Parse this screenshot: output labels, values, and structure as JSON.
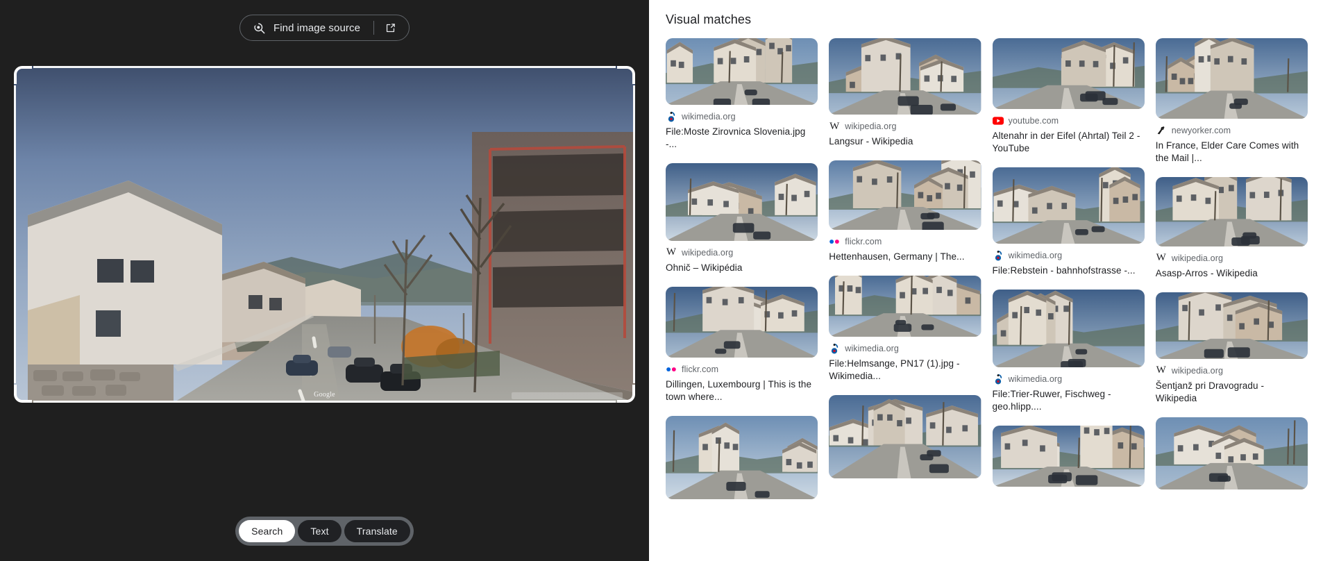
{
  "left": {
    "find_source": {
      "label": "Find image source",
      "search_icon": "image-search-lens-icon",
      "external_icon": "external-link-icon"
    },
    "image": {
      "watermark": "Google",
      "alt": "street-view-photo-of-village-road-with-houses"
    },
    "crop": {
      "handles": [
        "crop-handle-top-left",
        "crop-handle-top-right",
        "crop-handle-bottom-left",
        "crop-handle-bottom-right"
      ]
    },
    "modes": [
      {
        "label": "Search",
        "active": true
      },
      {
        "label": "Text",
        "active": false
      },
      {
        "label": "Translate",
        "active": false
      }
    ]
  },
  "right": {
    "title": "Visual matches",
    "columns": [
      [
        {
          "source": "wikimedia.org",
          "favicon": "wikimedia-icon",
          "title": "File:Moste Zirovnica Slovenia.jpg -...",
          "thumb_h": 96,
          "thumb": "village-street-white-houses"
        },
        {
          "source": "wikipedia.org",
          "favicon": "wikipedia-w-icon",
          "title": "Ohnič – Wikipédia",
          "thumb_h": 112,
          "thumb": "road-with-white-house-and-blue-sky"
        },
        {
          "source": "flickr.com",
          "favicon": "flickr-icon",
          "title": "Dillingen, Luxembourg | This is the town where...",
          "thumb_h": 102,
          "thumb": "beige-house-on-corner-street"
        },
        {
          "source": "",
          "favicon": "",
          "title": "",
          "thumb_h": 120,
          "thumb": "blue-sky-over-dark-roof"
        }
      ],
      [
        {
          "source": "wikipedia.org",
          "favicon": "wikipedia-w-icon",
          "title": "Langsur - Wikipedia",
          "thumb_h": 110,
          "thumb": "grey-stone-building-along-road"
        },
        {
          "source": "flickr.com",
          "favicon": "flickr-icon",
          "title": "Hettenhausen, Germany | The...",
          "thumb_h": 100,
          "thumb": "residential-street-with-green-hedge"
        },
        {
          "source": "wikimedia.org",
          "favicon": "wikimedia-icon",
          "title": "File:Helmsange, PN17 (1).jpg - Wikimedia...",
          "thumb_h": 88,
          "thumb": "crossroads-with-houses-and-cars"
        },
        {
          "source": "",
          "favicon": "",
          "title": "",
          "thumb_h": 120,
          "thumb": "hillside-village-houses"
        }
      ],
      [
        {
          "source": "youtube.com",
          "favicon": "youtube-icon",
          "title": "Altenahr in der Eifel (Ahrtal) Teil 2 - YouTube",
          "thumb_h": 102,
          "thumb": "village-street-with-yellow-building"
        },
        {
          "source": "wikimedia.org",
          "favicon": "wikimedia-icon",
          "title": "File:Rebstein - bahnhofstrasse -...",
          "thumb_h": 110,
          "thumb": "town-road-with-hills-in-distance"
        },
        {
          "source": "wikimedia.org",
          "favicon": "wikimedia-icon",
          "title": "File:Trier-Ruwer, Fischweg - geo.hlipp....",
          "thumb_h": 112,
          "thumb": "white-gabled-house-beside-road"
        },
        {
          "source": "",
          "favicon": "",
          "title": "",
          "thumb_h": 88,
          "thumb": "blue-sky-with-green-hill"
        }
      ],
      [
        {
          "source": "newyorker.com",
          "favicon": "newyorker-icon",
          "title": "In France, Elder Care Comes with the Mail |...",
          "thumb_h": 116,
          "thumb": "old-stone-corner-shop-building"
        },
        {
          "source": "wikipedia.org",
          "favicon": "wikipedia-w-icon",
          "title": "Asasp-Arros - Wikipedia",
          "thumb_h": 100,
          "thumb": "house-with-mountain-backdrop"
        },
        {
          "source": "wikipedia.org",
          "favicon": "wikipedia-w-icon",
          "title": "Šentjanž pri Dravogradu - Wikipedia",
          "thumb_h": 96,
          "thumb": "green-valley-with-parked-cars"
        },
        {
          "source": "",
          "favicon": "",
          "title": "",
          "thumb_h": 104,
          "thumb": "road-through-trees-and-houses"
        }
      ]
    ]
  },
  "colors": {
    "left_bg": "#1f1f1f",
    "right_bg": "#ffffff",
    "pill_track": "#5f6368",
    "pill_active_bg": "#ffffff",
    "text_primary": "#202124",
    "text_secondary": "#5f6368",
    "crop_handle": "#ffffff"
  }
}
